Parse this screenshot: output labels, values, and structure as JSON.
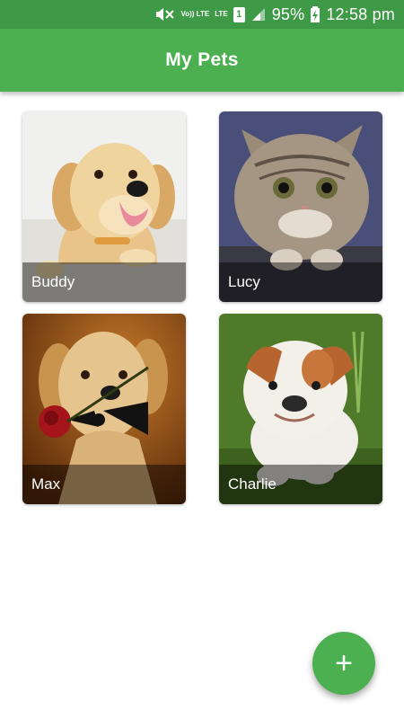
{
  "status_bar": {
    "volte_label": "Vo)) LTE",
    "lte_label": "LTE",
    "sim_label": "1",
    "battery_percent": "95%",
    "time": "12:58 pm",
    "icons": [
      "mute-icon",
      "signal-icon",
      "battery-charging-icon"
    ]
  },
  "app_bar": {
    "title": "My Pets"
  },
  "pets": [
    {
      "name": "Buddy",
      "image": "golden-retriever-puppy"
    },
    {
      "name": "Lucy",
      "image": "tabby-kitten"
    },
    {
      "name": "Max",
      "image": "puppy-with-rose"
    },
    {
      "name": "Charlie",
      "image": "bulldog-puppy"
    }
  ],
  "fab": {
    "label": "+",
    "icon": "add-icon"
  },
  "colors": {
    "status_bar": "#3e9a47",
    "app_bar": "#4caf50",
    "fab": "#4caf50"
  }
}
